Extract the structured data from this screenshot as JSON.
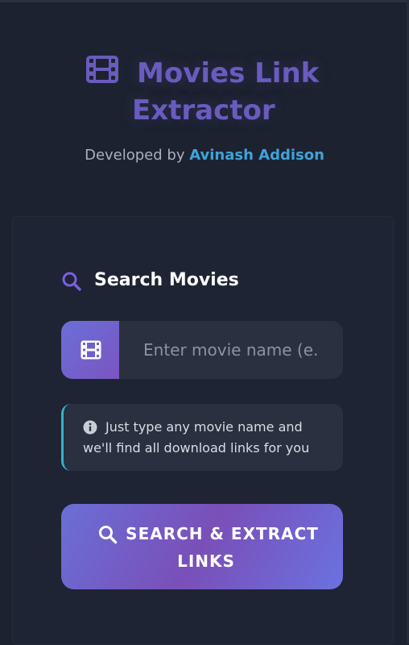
{
  "header": {
    "title_line1": "Movies Link",
    "title_line2": "Extractor",
    "subtitle_prefix": "Developed by ",
    "author": "Avinash Addison",
    "icon": "film-icon"
  },
  "search": {
    "section_title": "Search Movies",
    "section_icon": "search-icon",
    "input_icon": "film-icon",
    "placeholder": "Enter movie name (e.g",
    "value": ""
  },
  "hint": {
    "icon": "info-icon",
    "text": "Just type any movie name and we'll find all download links for you"
  },
  "button": {
    "icon": "search-icon",
    "label": "SEARCH & EXTRACT LINKS"
  },
  "colors": {
    "background": "#1d2230",
    "accent": "#6a5bbf",
    "author_link": "#3fa3d9",
    "hint_border": "#2fb5c8"
  }
}
